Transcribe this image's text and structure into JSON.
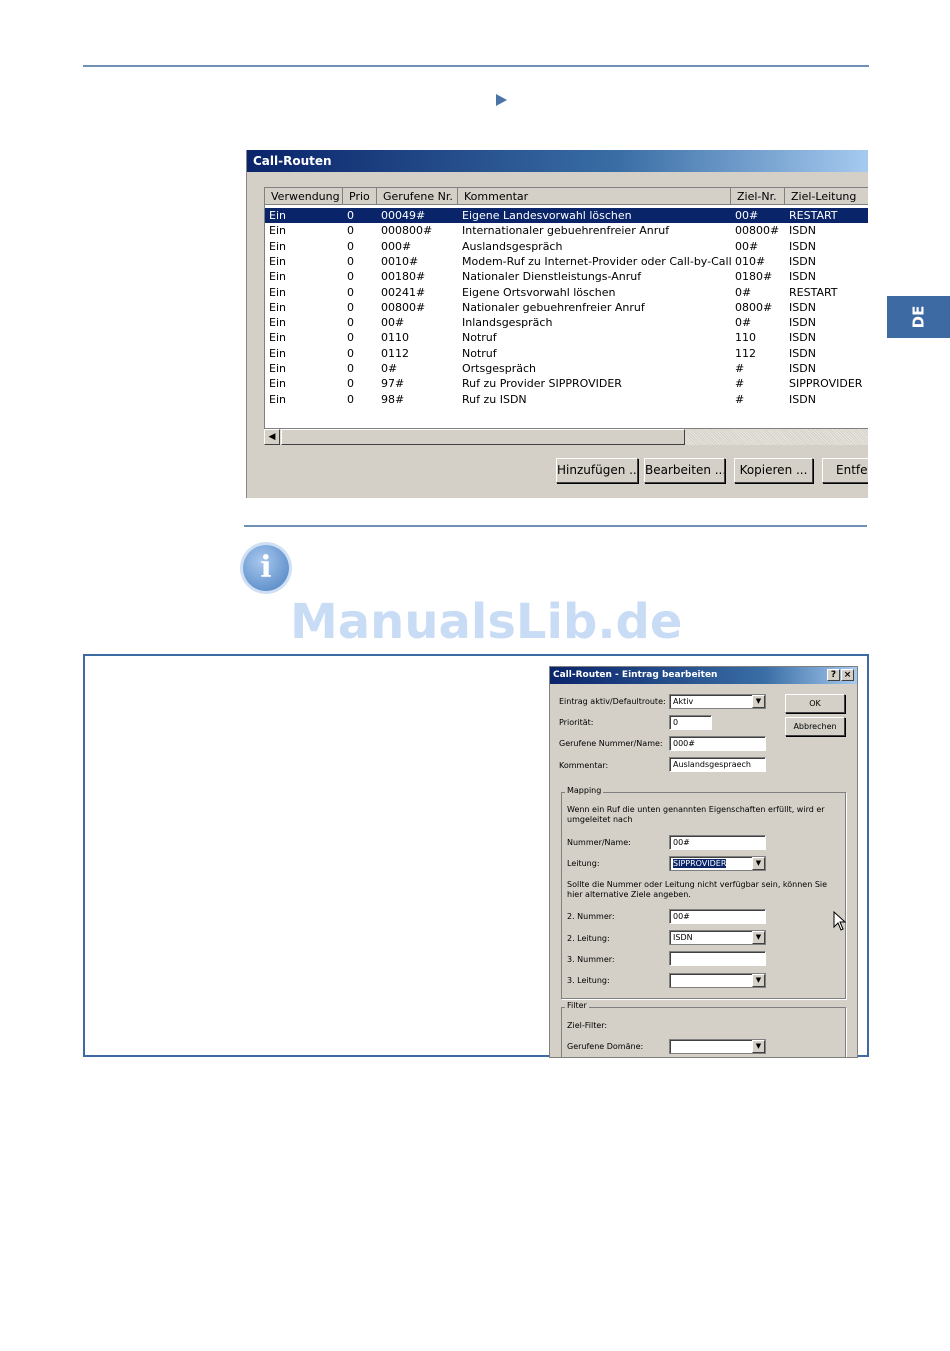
{
  "side_tab": "DE",
  "watermark": "ManualsLib.de",
  "call_routes_window": {
    "title": "Call-Routen",
    "columns": [
      "Verwendung",
      "Prio",
      "Gerufene Nr.",
      "Kommentar",
      "Ziel-Nr.",
      "Ziel-Leitung"
    ],
    "rows": [
      [
        "Ein",
        "0",
        "00049#",
        "Eigene Landesvorwahl löschen",
        "00#",
        "RESTART"
      ],
      [
        "Ein",
        "0",
        "000800#",
        "Internationaler gebuehrenfreier Anruf",
        "00800#",
        "ISDN"
      ],
      [
        "Ein",
        "0",
        "000#",
        "Auslandsgespräch",
        "00#",
        "ISDN"
      ],
      [
        "Ein",
        "0",
        "0010#",
        "Modem-Ruf zu Internet-Provider oder Call-by-Call",
        "010#",
        "ISDN"
      ],
      [
        "Ein",
        "0",
        "00180#",
        "Nationaler Dienstleistungs-Anruf",
        "0180#",
        "ISDN"
      ],
      [
        "Ein",
        "0",
        "00241#",
        "Eigene Ortsvorwahl löschen",
        "0#",
        "RESTART"
      ],
      [
        "Ein",
        "0",
        "00800#",
        "Nationaler gebuehrenfreier Anruf",
        "0800#",
        "ISDN"
      ],
      [
        "Ein",
        "0",
        "00#",
        "Inlandsgespräch",
        "0#",
        "ISDN"
      ],
      [
        "Ein",
        "0",
        "0110",
        "Notruf",
        "110",
        "ISDN"
      ],
      [
        "Ein",
        "0",
        "0112",
        "Notruf",
        "112",
        "ISDN"
      ],
      [
        "Ein",
        "0",
        "0#",
        "Ortsgespräch",
        "#",
        "ISDN"
      ],
      [
        "Ein",
        "0",
        "97#",
        "Ruf zu Provider SIPPROVIDER",
        "#",
        "SIPPROVIDER"
      ],
      [
        "Ein",
        "0",
        "98#",
        "Ruf zu ISDN",
        "#",
        "ISDN"
      ]
    ],
    "selected_row": 0,
    "buttons": {
      "add": "Hinzufügen ...",
      "edit": "Bearbeiten ...",
      "copy": "Kopieren ...",
      "remove": "Entfer"
    }
  },
  "edit_dialog": {
    "title": "Call-Routen - Eintrag bearbeiten",
    "help": "?",
    "close": "×",
    "ok": "OK",
    "cancel": "Abbrechen",
    "active_label": "Eintrag aktiv/Defaultroute:",
    "active_value": "Aktiv",
    "priority_label": "Priorität:",
    "priority_value": "0",
    "called_label": "Gerufene Nummer/Name:",
    "called_value": "000#",
    "comment_label": "Kommentar:",
    "comment_value": "Auslandsgespraech",
    "mapping_caption": "Mapping",
    "mapping_text": "Wenn ein Ruf die unten genannten Eigenschaften erfüllt, wird er umgeleitet nach",
    "number_label": "Nummer/Name:",
    "number_value": "00#",
    "line_label": "Leitung:",
    "line_value": "SIPPROVIDER",
    "alt_text": "Sollte die Nummer oder Leitung nicht verfügbar sein, können Sie hier alternative Ziele angeben.",
    "number2_label": "2. Nummer:",
    "number2_value": "00#",
    "line2_label": "2. Leitung:",
    "line2_value": "ISDN",
    "number3_label": "3. Nummer:",
    "number3_value": "",
    "line3_label": "3. Leitung:",
    "line3_value": "",
    "filter_caption": "Filter",
    "target_filter_label": "Ziel-Filter:",
    "called_domain_label": "Gerufene Domäne:",
    "called_domain_value": ""
  }
}
